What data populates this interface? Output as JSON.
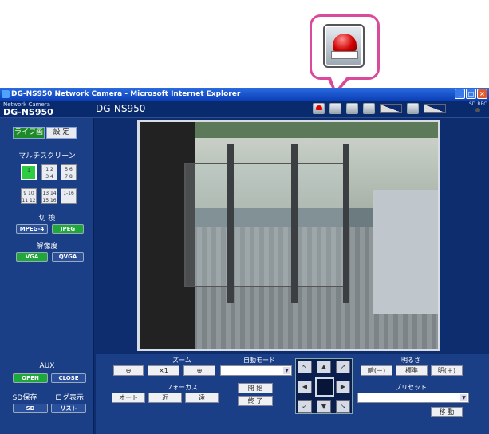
{
  "window": {
    "title": "DG-NS950 Network Camera - Microsoft Internet Explorer",
    "buttons": [
      "_",
      "□",
      "×"
    ]
  },
  "header": {
    "brand_small": "Network Camera",
    "brand_big": "DG-NS950",
    "model": "DG-NS950",
    "sd_rec": "SD REC",
    "icons": [
      "alarm-icon",
      "full-screen-icon",
      "snapshot-icon",
      "speaker-icon",
      "volume-bar-icon",
      "mic-mute-icon",
      "mic-volume-bar-icon"
    ]
  },
  "left": {
    "tab_live": "ライブ画",
    "tab_settings": "設 定",
    "multiscreen_label": "マルチスクリーン",
    "split_buttons": [
      {
        "label": "1",
        "active": true
      },
      {
        "label": "1 2\n3 4",
        "active": false
      },
      {
        "label": "5 6\n7 8",
        "active": false
      },
      {
        "label": "9 10\n11 12",
        "active": false
      },
      {
        "label": "13 14\n15 16",
        "active": false
      },
      {
        "label": "1-16",
        "active": false
      }
    ],
    "switch_label": "切 換",
    "switch_mpeg4": "MPEG-4",
    "switch_jpeg": "JPEG",
    "resolution_label": "解像度",
    "res_vga": "VGA",
    "res_qvga": "QVGA",
    "aux_label": "AUX",
    "aux_open": "OPEN",
    "aux_close": "CLOSE",
    "sd_save_label": "SD保存",
    "log_label": "ログ表示",
    "sd_btn": "SD",
    "list_btn": "リスト"
  },
  "controls": {
    "zoom_label": "ズーム",
    "zoom_out": "⊖",
    "zoom_x1": "×1",
    "zoom_in": "⊕",
    "focus_label": "フォーカス",
    "focus_auto": "オート",
    "focus_near": "近",
    "focus_far": "遠",
    "automode_label": "自動モード",
    "automode_value": "",
    "start": "開 始",
    "end": "終 了",
    "brightness_label": "明るさ",
    "bright_dark": "暗(－)",
    "bright_std": "標準",
    "bright_light": "明(＋)",
    "preset_label": "プリセット",
    "preset_value": "",
    "move": "移 動"
  }
}
